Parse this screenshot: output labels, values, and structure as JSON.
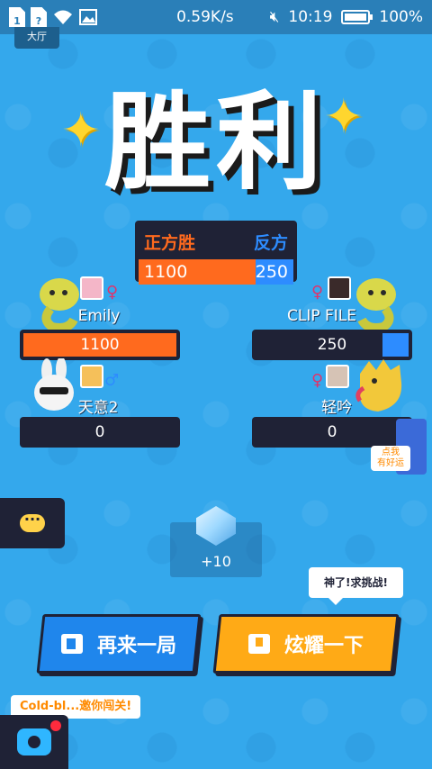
{
  "status_bar": {
    "speed": "0.59K/s",
    "time": "10:19",
    "battery": "100%"
  },
  "hall_tab": "大厅",
  "result_title": "胜利",
  "score_panel": {
    "left_label": "正方胜",
    "right_label": "反方",
    "left_score": "1100",
    "right_score": "250"
  },
  "players": {
    "p1": {
      "name": "Emily",
      "score": "1100",
      "fill": 1.0
    },
    "p2": {
      "name": "CLIP FILE",
      "score": "250",
      "fill": 0.25
    },
    "p3": {
      "name": "天意2",
      "score": "0",
      "fill": 0
    },
    "p4": {
      "name": "轻吟",
      "score": "0",
      "fill": 0
    }
  },
  "reward": {
    "value": "+10"
  },
  "challenge_tip": "神了!求挑战!",
  "buttons": {
    "again": "再来一局",
    "share": "炫耀一下"
  },
  "invite_tip": "Cold-bl...邀你闯关!",
  "lucky_badge": {
    "line1": "点我",
    "line2": "有好运"
  },
  "colors": {
    "background": "#34a8ec",
    "red_team": "#ff6a1e",
    "blue_team": "#2d8cff",
    "dark_panel": "#1f2236",
    "orange_button": "#ffaa16",
    "blue_button": "#1f86ec"
  }
}
